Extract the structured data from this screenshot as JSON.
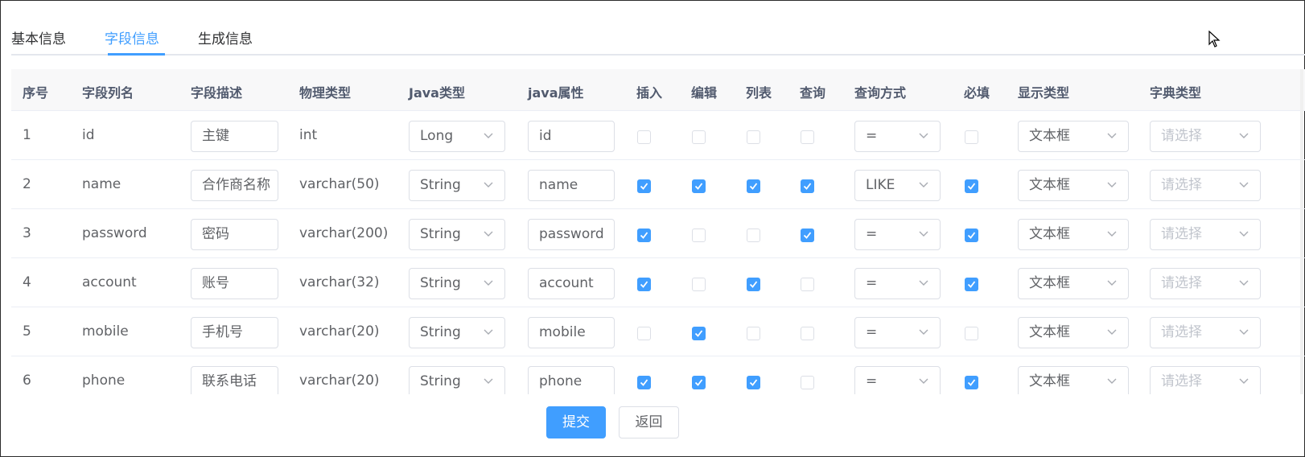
{
  "tabs": [
    {
      "label": "基本信息",
      "active": false
    },
    {
      "label": "字段信息",
      "active": true
    },
    {
      "label": "生成信息",
      "active": false
    }
  ],
  "table": {
    "headers": [
      "序号",
      "字段列名",
      "字段描述",
      "物理类型",
      "Java类型",
      "java属性",
      "插入",
      "编辑",
      "列表",
      "查询",
      "查询方式",
      "必填",
      "显示类型",
      "字典类型"
    ],
    "rows": [
      {
        "index": "1",
        "column": "id",
        "desc": "主键",
        "physical": "int",
        "javaType": "Long",
        "javaField": "id",
        "insert": false,
        "edit": false,
        "list": false,
        "query": false,
        "queryType": "=",
        "required": false,
        "htmlType": "文本框",
        "dict": "请选择"
      },
      {
        "index": "2",
        "column": "name",
        "desc": "合作商名称",
        "physical": "varchar(50)",
        "javaType": "String",
        "javaField": "name",
        "insert": true,
        "edit": true,
        "list": true,
        "query": true,
        "queryType": "LIKE",
        "required": true,
        "htmlType": "文本框",
        "dict": "请选择"
      },
      {
        "index": "3",
        "column": "password",
        "desc": "密码",
        "physical": "varchar(200)",
        "javaType": "String",
        "javaField": "password",
        "insert": true,
        "edit": false,
        "list": false,
        "query": true,
        "queryType": "=",
        "required": true,
        "htmlType": "文本框",
        "dict": "请选择"
      },
      {
        "index": "4",
        "column": "account",
        "desc": "账号",
        "physical": "varchar(32)",
        "javaType": "String",
        "javaField": "account",
        "insert": true,
        "edit": false,
        "list": true,
        "query": false,
        "queryType": "=",
        "required": true,
        "htmlType": "文本框",
        "dict": "请选择"
      },
      {
        "index": "5",
        "column": "mobile",
        "desc": "手机号",
        "physical": "varchar(20)",
        "javaType": "String",
        "javaField": "mobile",
        "insert": false,
        "edit": true,
        "list": false,
        "query": false,
        "queryType": "=",
        "required": false,
        "htmlType": "文本框",
        "dict": "请选择"
      },
      {
        "index": "6",
        "column": "phone",
        "desc": "联系电话",
        "physical": "varchar(20)",
        "javaType": "String",
        "javaField": "phone",
        "insert": true,
        "edit": true,
        "list": true,
        "query": false,
        "queryType": "=",
        "required": true,
        "htmlType": "文本框",
        "dict": "请选择"
      }
    ]
  },
  "actions": {
    "submit": "提交",
    "back": "返回"
  },
  "colors": {
    "accent": "#409eff",
    "border": "#dcdfe6",
    "header_bg": "#f8f8f9"
  }
}
